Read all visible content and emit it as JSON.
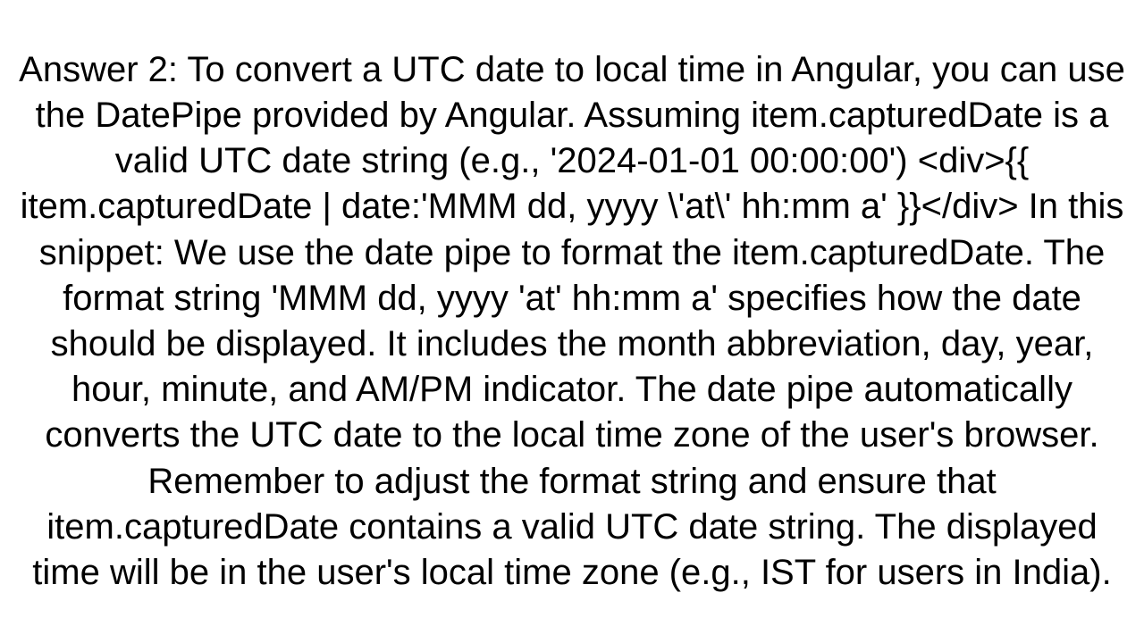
{
  "answer": {
    "text": "Answer 2: To convert a UTC date to local time in Angular, you can use the DatePipe provided by Angular. Assuming item.capturedDate is a valid UTC date string (e.g., '2024-01-01 00:00:00') <div>{{ item.capturedDate | date:'MMM dd, yyyy \\'at\\' hh:mm a' }}</div>  In this snippet:  We use the date pipe to format the item.capturedDate. The format string 'MMM dd, yyyy 'at' hh:mm a' specifies how the date should be displayed. It includes the month abbreviation, day, year, hour, minute, and AM/PM indicator. The date pipe automatically converts the UTC date to the local time zone of the user's browser.  Remember to adjust the format string and ensure that item.capturedDate contains a valid UTC date string. The displayed time will be in the user's local time zone (e.g., IST for users in India)."
  }
}
